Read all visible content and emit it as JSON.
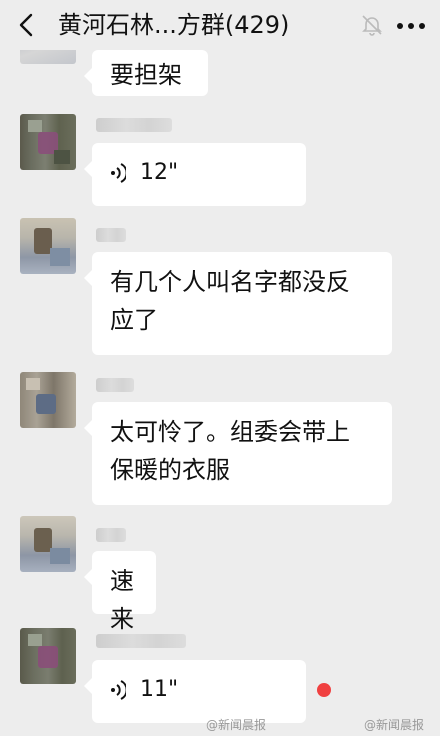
{
  "header": {
    "title": "黄河石林...方群(429)",
    "back_icon": "chevron-left-icon",
    "mute_icon": "bell-muted-icon",
    "more_icon": "more-dots-icon"
  },
  "messages": [
    {
      "type": "text",
      "text": "要担架"
    },
    {
      "type": "voice",
      "duration": "12\""
    },
    {
      "type": "text",
      "line1": "有几个人叫名字都没反",
      "line2": "应了"
    },
    {
      "type": "text",
      "line1": "太可怜了。组委会带上",
      "line2": "保暖的衣服"
    },
    {
      "type": "text",
      "text": "速来"
    },
    {
      "type": "voice",
      "duration": "11\"",
      "unread": true
    }
  ],
  "watermark": {
    "left": "@新闻晨报",
    "right": "@新闻晨报"
  }
}
